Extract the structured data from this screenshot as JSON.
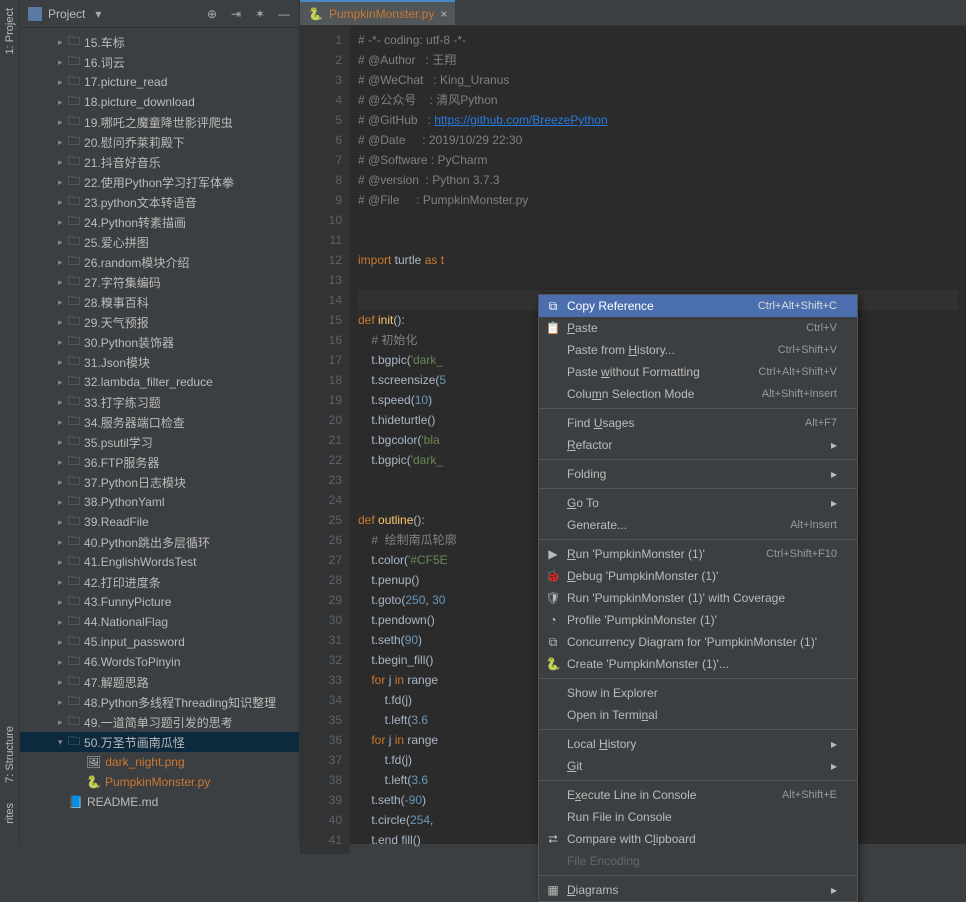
{
  "sidebar": {
    "title": "Project",
    "rail_labels": [
      "1: Project",
      "7: Structure",
      "rites"
    ],
    "tree": [
      {
        "label": "15.车标",
        "indent": 1
      },
      {
        "label": "16.词云",
        "indent": 1
      },
      {
        "label": "17.picture_read",
        "indent": 1
      },
      {
        "label": "18.picture_download",
        "indent": 1
      },
      {
        "label": "19.哪吒之魔童降世影评爬虫",
        "indent": 1
      },
      {
        "label": "20.慰问乔莱莉殿下",
        "indent": 1
      },
      {
        "label": "21.抖音好音乐",
        "indent": 1
      },
      {
        "label": "22.使用Python学习打军体拳",
        "indent": 1
      },
      {
        "label": "23.python文本转语音",
        "indent": 1
      },
      {
        "label": "24.Python转素描画",
        "indent": 1
      },
      {
        "label": "25.爱心拼图",
        "indent": 1
      },
      {
        "label": "26.random模块介绍",
        "indent": 1
      },
      {
        "label": "27.字符集编码",
        "indent": 1
      },
      {
        "label": "28.糗事百科",
        "indent": 1
      },
      {
        "label": "29.天气预报",
        "indent": 1
      },
      {
        "label": "30.Python装饰器",
        "indent": 1
      },
      {
        "label": "31.Json模块",
        "indent": 1
      },
      {
        "label": "32.lambda_filter_reduce",
        "indent": 1
      },
      {
        "label": "33.打字练习题",
        "indent": 1
      },
      {
        "label": "34.服务器端口检查",
        "indent": 1
      },
      {
        "label": "35.psutil学习",
        "indent": 1
      },
      {
        "label": "36.FTP服务器",
        "indent": 1
      },
      {
        "label": "37.Python日志模块",
        "indent": 1
      },
      {
        "label": "38.PythonYaml",
        "indent": 1
      },
      {
        "label": "39.ReadFile",
        "indent": 1
      },
      {
        "label": "40.Python跳出多层循环",
        "indent": 1
      },
      {
        "label": "41.EnglishWordsTest",
        "indent": 1
      },
      {
        "label": "42.打印进度条",
        "indent": 1
      },
      {
        "label": "43.FunnyPicture",
        "indent": 1
      },
      {
        "label": "44.NationalFlag",
        "indent": 1
      },
      {
        "label": "45.input_password",
        "indent": 1
      },
      {
        "label": "46.WordsToPinyin",
        "indent": 1
      },
      {
        "label": "47.解题思路",
        "indent": 1
      },
      {
        "label": "48.Python多线程Threading知识整理",
        "indent": 1
      },
      {
        "label": "49.一道简单习题引发的思考",
        "indent": 1
      },
      {
        "label": "50.万圣节画南瓜怪",
        "indent": 1,
        "open": true
      },
      {
        "label": "dark_night.png",
        "indent": 2,
        "file": "img"
      },
      {
        "label": "PumpkinMonster.py",
        "indent": 2,
        "file": "py"
      },
      {
        "label": "README.md",
        "indent": 1,
        "file": "md",
        "cut": true
      }
    ]
  },
  "tab": {
    "label": "PumpkinMonster.py"
  },
  "code": {
    "lines": [
      {
        "n": 1,
        "segs": [
          [
            "c",
            "#"
          ],
          [
            "c",
            " -*- coding: utf-8 -*-"
          ]
        ]
      },
      {
        "n": 2,
        "segs": [
          [
            "c",
            "# @Author   : 王翔"
          ]
        ]
      },
      {
        "n": 3,
        "segs": [
          [
            "c",
            "# @WeChat   : King_Uranus"
          ]
        ]
      },
      {
        "n": 4,
        "segs": [
          [
            "c",
            "# @公众号    : 清风Python"
          ]
        ]
      },
      {
        "n": 5,
        "segs": [
          [
            "c",
            "# @GitHub   : "
          ],
          [
            "u",
            "https://github.com/BreezePython"
          ]
        ]
      },
      {
        "n": 6,
        "segs": [
          [
            "c",
            "# @Date     : 2019/10/29 22:30"
          ]
        ]
      },
      {
        "n": 7,
        "segs": [
          [
            "c",
            "# @Software : PyCharm"
          ]
        ]
      },
      {
        "n": 8,
        "segs": [
          [
            "c",
            "# @version  : Python 3.7.3"
          ]
        ]
      },
      {
        "n": 9,
        "segs": [
          [
            "c",
            "# @File     : PumpkinMonster.py"
          ]
        ]
      },
      {
        "n": 10,
        "segs": []
      },
      {
        "n": 11,
        "segs": []
      },
      {
        "n": 12,
        "segs": [
          [
            "k",
            "import"
          ],
          [
            "p",
            " turtle "
          ],
          [
            "k",
            "as"
          ],
          [
            "p",
            " "
          ],
          [
            "k",
            "t"
          ]
        ]
      },
      {
        "n": 13,
        "segs": []
      },
      {
        "n": 14,
        "segs": [],
        "caret": true
      },
      {
        "n": 15,
        "segs": [
          [
            "k",
            "def "
          ],
          [
            "f",
            "init"
          ],
          [
            "p",
            "():"
          ]
        ]
      },
      {
        "n": 16,
        "segs": [
          [
            "p",
            "    "
          ],
          [
            "c",
            "# 初始化"
          ]
        ]
      },
      {
        "n": 17,
        "segs": [
          [
            "p",
            "    t.bgpic("
          ],
          [
            "s",
            "'dark_"
          ]
        ]
      },
      {
        "n": 18,
        "segs": [
          [
            "p",
            "    t.screensize("
          ],
          [
            "n",
            "5"
          ]
        ]
      },
      {
        "n": 19,
        "segs": [
          [
            "p",
            "    t.speed("
          ],
          [
            "n",
            "10"
          ],
          [
            "p",
            ")"
          ]
        ]
      },
      {
        "n": 20,
        "segs": [
          [
            "p",
            "    t.hideturtle()"
          ]
        ]
      },
      {
        "n": 21,
        "segs": [
          [
            "p",
            "    t.bgcolor("
          ],
          [
            "s",
            "'bla"
          ]
        ]
      },
      {
        "n": 22,
        "segs": [
          [
            "p",
            "    t.bgpic("
          ],
          [
            "s",
            "'dark_"
          ]
        ]
      },
      {
        "n": 23,
        "segs": []
      },
      {
        "n": 24,
        "segs": []
      },
      {
        "n": 25,
        "segs": [
          [
            "k",
            "def "
          ],
          [
            "f",
            "outline"
          ],
          [
            "p",
            "():"
          ]
        ]
      },
      {
        "n": 26,
        "segs": [
          [
            "p",
            "    "
          ],
          [
            "c",
            "#  绘制南瓜轮廓"
          ]
        ]
      },
      {
        "n": 27,
        "segs": [
          [
            "p",
            "    t.color("
          ],
          [
            "s",
            "'#CF5E"
          ]
        ]
      },
      {
        "n": 28,
        "segs": [
          [
            "p",
            "    t.penup()"
          ]
        ]
      },
      {
        "n": 29,
        "segs": [
          [
            "p",
            "    t.goto("
          ],
          [
            "n",
            "250"
          ],
          [
            "p",
            ", "
          ],
          [
            "n",
            "30"
          ]
        ]
      },
      {
        "n": 30,
        "segs": [
          [
            "p",
            "    t.pendown()"
          ]
        ]
      },
      {
        "n": 31,
        "segs": [
          [
            "p",
            "    t.seth("
          ],
          [
            "n",
            "90"
          ],
          [
            "p",
            ")"
          ]
        ]
      },
      {
        "n": 32,
        "segs": [
          [
            "p",
            "    t.begin_fill()"
          ]
        ]
      },
      {
        "n": 33,
        "segs": [
          [
            "p",
            "    "
          ],
          [
            "k",
            "for"
          ],
          [
            "p",
            " j "
          ],
          [
            "k",
            "in"
          ],
          [
            "p",
            " range"
          ]
        ]
      },
      {
        "n": 34,
        "segs": [
          [
            "p",
            "        t.fd(j)"
          ]
        ]
      },
      {
        "n": 35,
        "segs": [
          [
            "p",
            "        t.left("
          ],
          [
            "n",
            "3.6"
          ]
        ]
      },
      {
        "n": 36,
        "segs": [
          [
            "p",
            "    "
          ],
          [
            "k",
            "for"
          ],
          [
            "p",
            " j "
          ],
          [
            "k",
            "in"
          ],
          [
            "p",
            " range"
          ]
        ]
      },
      {
        "n": 37,
        "segs": [
          [
            "p",
            "        t.fd(j)"
          ]
        ]
      },
      {
        "n": 38,
        "segs": [
          [
            "p",
            "        t.left("
          ],
          [
            "n",
            "3.6"
          ]
        ]
      },
      {
        "n": 39,
        "segs": [
          [
            "p",
            "    t.seth("
          ],
          [
            "n",
            "-90"
          ],
          [
            "p",
            ")"
          ]
        ]
      },
      {
        "n": 40,
        "segs": [
          [
            "p",
            "    t.circle("
          ],
          [
            "n",
            "254"
          ],
          [
            "p",
            ","
          ]
        ]
      },
      {
        "n": 41,
        "segs": [
          [
            "p",
            "    t.end fill()"
          ]
        ]
      }
    ]
  },
  "menu": {
    "items": [
      {
        "label": "Copy Reference",
        "shortcut": "Ctrl+Alt+Shift+C",
        "hl": true,
        "icon": "copy"
      },
      {
        "label": "Paste",
        "shortcut": "Ctrl+V",
        "icon": "paste",
        "u": 0
      },
      {
        "label": "Paste from History...",
        "shortcut": "Ctrl+Shift+V",
        "u": 11
      },
      {
        "label": "Paste without Formatting",
        "shortcut": "Ctrl+Alt+Shift+V",
        "u": 6
      },
      {
        "label": "Column Selection Mode",
        "shortcut": "Alt+Shift+Insert",
        "u": 4
      },
      {
        "sep": true
      },
      {
        "label": "Find Usages",
        "shortcut": "Alt+F7",
        "u": 5
      },
      {
        "label": "Refactor",
        "arrow": true,
        "u": 0
      },
      {
        "sep": true
      },
      {
        "label": "Folding",
        "arrow": true
      },
      {
        "sep": true
      },
      {
        "label": "Go To",
        "arrow": true,
        "u": 0
      },
      {
        "label": "Generate...",
        "shortcut": "Alt+Insert"
      },
      {
        "sep": true
      },
      {
        "label": "Run 'PumpkinMonster (1)'",
        "shortcut": "Ctrl+Shift+F10",
        "icon": "run",
        "u": 0
      },
      {
        "label": "Debug 'PumpkinMonster (1)'",
        "icon": "debug",
        "u": 0
      },
      {
        "label": "Run 'PumpkinMonster (1)' with Coverage",
        "icon": "coverage"
      },
      {
        "label": "Profile 'PumpkinMonster (1)'",
        "icon": "profile"
      },
      {
        "label": "Concurrency Diagram for 'PumpkinMonster (1)'",
        "icon": "concurrency"
      },
      {
        "label": "Create 'PumpkinMonster (1)'...",
        "icon": "python"
      },
      {
        "sep": true
      },
      {
        "label": "Show in Explorer"
      },
      {
        "label": "Open in Terminal",
        "u": 13
      },
      {
        "sep": true
      },
      {
        "label": "Local History",
        "arrow": true,
        "u": 6
      },
      {
        "label": "Git",
        "arrow": true,
        "u": 0
      },
      {
        "sep": true
      },
      {
        "label": "Execute Line in Console",
        "shortcut": "Alt+Shift+E",
        "u": 1
      },
      {
        "label": "Run File in Console"
      },
      {
        "label": "Compare with Clipboard",
        "icon": "diff",
        "u": 14
      },
      {
        "label": "File Encoding",
        "disabled": true
      },
      {
        "sep": true
      },
      {
        "label": "Diagrams",
        "arrow": true,
        "u": 0,
        "icon": "diagram"
      }
    ]
  }
}
